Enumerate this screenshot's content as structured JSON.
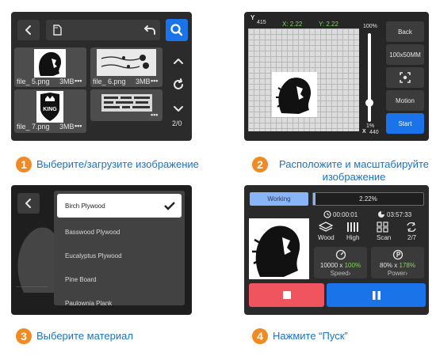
{
  "panel1": {
    "files": [
      {
        "name": "file_ 5.png",
        "size": "3MB",
        "more": "•••"
      },
      {
        "name": "file_ 6.png",
        "size": "3MB",
        "more": "•••"
      },
      {
        "name": "file_ 7.png",
        "size": "3MB",
        "more": "•••"
      },
      {
        "name": "",
        "size": "",
        "more": "•••"
      }
    ],
    "king_text": "KING",
    "page": "2/0"
  },
  "panel2": {
    "y_label": "Y",
    "y_value": "415",
    "x_coord": "X: 2.22",
    "y_coord": "Y: 2.22",
    "zoom_top": "100%",
    "zoom_bottom": "1%",
    "x_label": "X",
    "x_value": "440",
    "buttons": {
      "back": "Back",
      "size": "100x50MM",
      "motion": "Motion",
      "start": "Start"
    },
    "accent": "#1a73e8",
    "coord_color": "#7ed957"
  },
  "panel3": {
    "materials": [
      "Birch Plywood",
      "Basswood Plywood",
      "Eucalyptus Plywood",
      "Pine Board",
      "Paulownia Plank"
    ],
    "selected_index": 0
  },
  "panel4": {
    "status": "Working",
    "progress_text": "2.22%",
    "progress": 0.0222,
    "elapsed": "00:00:01",
    "remaining": "03:57:33",
    "material": "Wood",
    "quality": "High",
    "mode": "Scan",
    "passes": "2/7",
    "speed_base": "10000 x ",
    "speed_pct": "100%",
    "speed_label": "Speed",
    "power_base": "80% x ",
    "power_pct": "178%",
    "power_label": "Power",
    "stop_color": "#f0545f",
    "pause_color": "#1a73e8"
  },
  "steps": [
    {
      "num": "1",
      "text": "Выберите/загрузите изображение"
    },
    {
      "num": "2",
      "text": "Расположите и масштабируйте изображение"
    },
    {
      "num": "3",
      "text": "Выберите материал"
    },
    {
      "num": "4",
      "text": "Нажмите “Пуск”"
    }
  ]
}
